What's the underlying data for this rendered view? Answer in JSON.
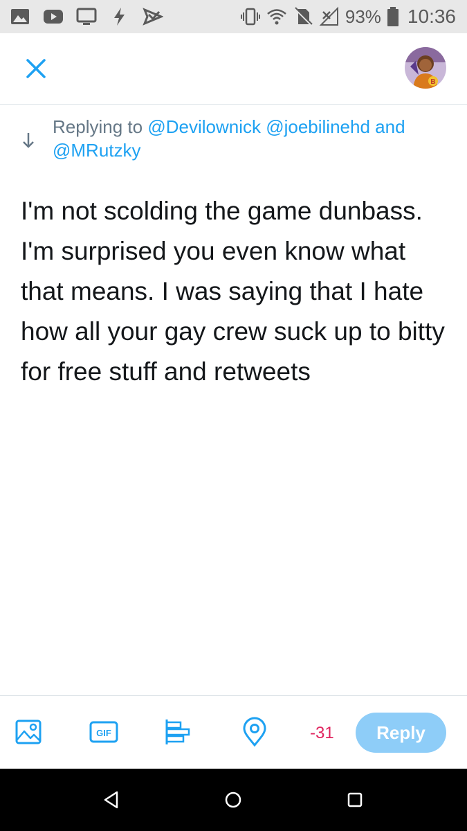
{
  "status_bar": {
    "battery": "93%",
    "time": "10:36",
    "left_icons": [
      "photo-icon",
      "youtube-icon",
      "tv-icon",
      "bolt-icon",
      "send-icon"
    ],
    "right_icons": [
      "vibrate-icon",
      "wifi-icon",
      "no-sim-icon",
      "signal-icon",
      "battery-icon"
    ]
  },
  "header": {
    "close_icon": "close-icon",
    "avatar_letter": "B"
  },
  "reply_context": {
    "prefix": "Replying to",
    "mention_1": "@Devilownick",
    "mention_2": "@joebilinehd",
    "conjunction": "and",
    "mention_3": "@MRutzky"
  },
  "tweet": {
    "text": "I'm not scolding the game dunbass. I'm surprised you even know what that means. I was saying that I hate how all your gay crew suck up to bitty for free stuff and retweets"
  },
  "toolbar": {
    "icons": [
      "image-icon",
      "gif-icon",
      "poll-icon",
      "location-icon"
    ],
    "gif_label": "GIF",
    "char_count": "-31",
    "reply_label": "Reply"
  },
  "colors": {
    "accent": "#1da1f2",
    "reply_button_disabled": "#8ecdf8",
    "char_count_over": "#e0245e",
    "text": "#14171a",
    "secondary_text": "#657786"
  },
  "nav": {
    "buttons": [
      "back-icon",
      "home-icon",
      "recents-icon"
    ]
  }
}
